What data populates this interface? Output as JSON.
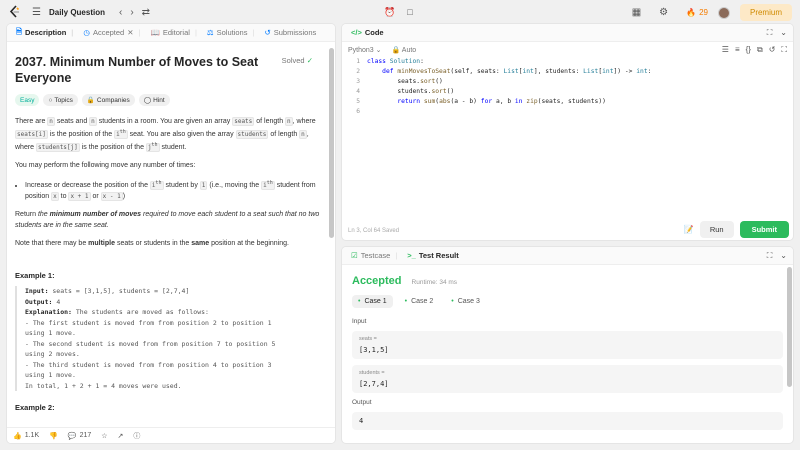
{
  "topbar": {
    "title": "Daily Question",
    "streak": "29",
    "premium": "Premium"
  },
  "desc_tabs": [
    {
      "label": "Description",
      "icon": "document-icon"
    },
    {
      "label": "Accepted",
      "icon": "clock-icon"
    },
    {
      "label": "Editorial",
      "icon": "book-icon"
    },
    {
      "label": "Solutions",
      "icon": "flask-icon"
    },
    {
      "label": "Submissions",
      "icon": "history-icon"
    }
  ],
  "problem": {
    "title": "2037. Minimum Number of Moves to Seat Everyone",
    "status": "Solved",
    "difficulty": "Easy",
    "topics": "Topics",
    "companies": "Companies",
    "hint": "Hint",
    "likes": "1.1K",
    "comments": "217"
  },
  "code_panel": {
    "tab": "Code",
    "language": "Python3",
    "mode": "Auto",
    "status": "Ln 3, Col 64   Saved",
    "run": "Run",
    "submit": "Submit"
  },
  "code_lines": [
    "class Solution:",
    "    def minMovesToSeat(self, seats: List[int], students: List[int]) -> int:",
    "        seats.sort()",
    "        students.sort()",
    "        return sum(abs(a - b) for a, b in zip(seats, students))",
    ""
  ],
  "result_panel": {
    "tab_testcase": "Testcase",
    "tab_result": "Test Result",
    "verdict": "Accepted",
    "runtime": "Runtime: 34 ms",
    "cases": [
      "Case 1",
      "Case 2",
      "Case 3"
    ],
    "input_label": "Input",
    "seats_name": "seats =",
    "seats_value": "[3,1,5]",
    "students_name": "students =",
    "students_value": "[2,7,4]",
    "output_label": "Output",
    "output_value": "4"
  }
}
